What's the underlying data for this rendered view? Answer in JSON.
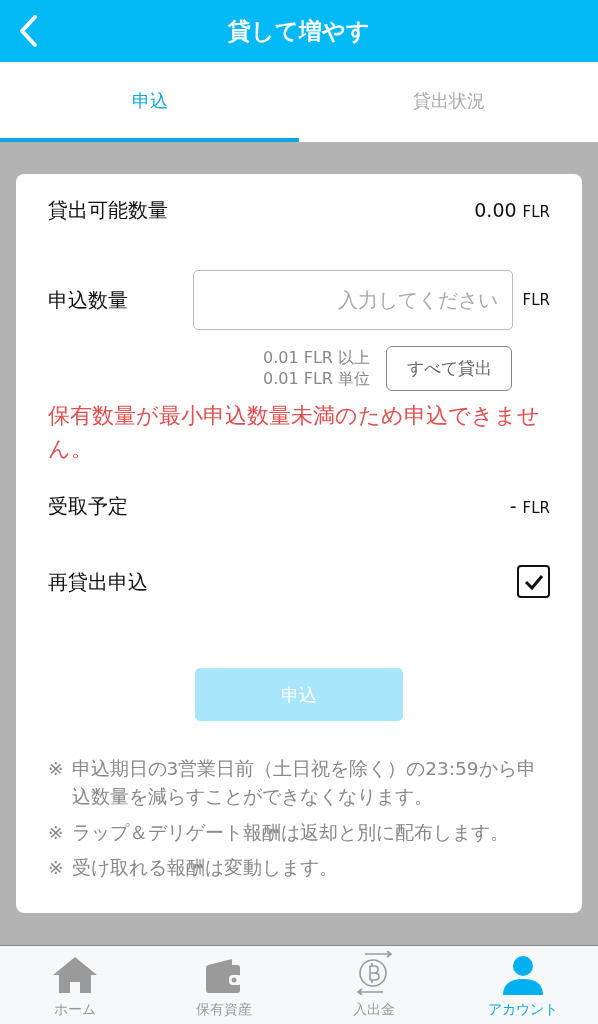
{
  "header": {
    "title": "貸して増やす"
  },
  "tabs": [
    {
      "label": "申込",
      "selected": true
    },
    {
      "label": "貸出状況",
      "selected": false
    }
  ],
  "form": {
    "available": {
      "label": "貸出可能数量",
      "value": "0.00",
      "unit": "FLR"
    },
    "amount": {
      "label": "申込数量",
      "placeholder": "入力してください",
      "unit": "FLR"
    },
    "hints": [
      "0.01 FLR 以上",
      "0.01 FLR 単位"
    ],
    "all_button": "すべて貸出",
    "error": "保有数量が最小申込数量未満のため申込できません。",
    "receive": {
      "label": "受取予定",
      "value": "-",
      "unit": "FLR"
    },
    "relend": {
      "label": "再貸出申込",
      "checked": true
    },
    "submit": {
      "label": "申込",
      "disabled": true
    },
    "notes": [
      {
        "mark": "※",
        "text": "申込期日の3営業日前（土日祝を除く）の23:59から申込数量を減らすことができなくなります。"
      },
      {
        "mark": "※",
        "text": "ラップ＆デリゲート報酬は返却と別に配布します。"
      },
      {
        "mark": "※",
        "text": "受け取れる報酬は変動します。"
      }
    ]
  },
  "bottom_nav": [
    {
      "kind": "home",
      "label": "ホーム",
      "selected": false
    },
    {
      "kind": "wallet",
      "label": "保有資産",
      "selected": false
    },
    {
      "kind": "transfer",
      "label": "入出金",
      "selected": false
    },
    {
      "kind": "account",
      "label": "アカウント",
      "selected": true
    }
  ]
}
